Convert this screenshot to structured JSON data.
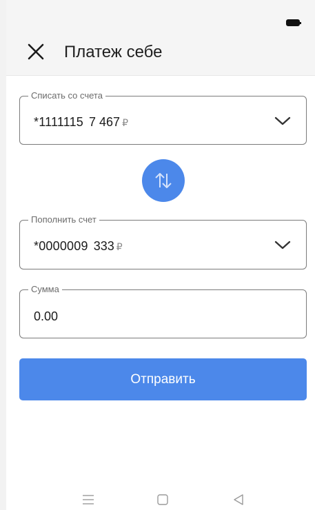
{
  "header": {
    "title": "Платеж себе",
    "close_icon": "close-icon",
    "battery_icon": "battery-icon"
  },
  "from_account": {
    "label": "Списать со счета",
    "number": "*1111115",
    "amount": "7 467",
    "currency": "₽"
  },
  "swap": {
    "icon": "swap-arrows-icon"
  },
  "to_account": {
    "label": "Пополнить счет",
    "number": "*0000009",
    "amount": "333",
    "currency": "₽"
  },
  "sum": {
    "label": "Сумма",
    "value": "0.00"
  },
  "send_button": {
    "label": "Отправить"
  },
  "navbar": {
    "items": [
      "menu-icon",
      "home-icon",
      "back-icon"
    ]
  },
  "colors": {
    "accent": "#4c88ea",
    "header_bg": "#f5f5f5",
    "border": "#7a7a7a"
  }
}
